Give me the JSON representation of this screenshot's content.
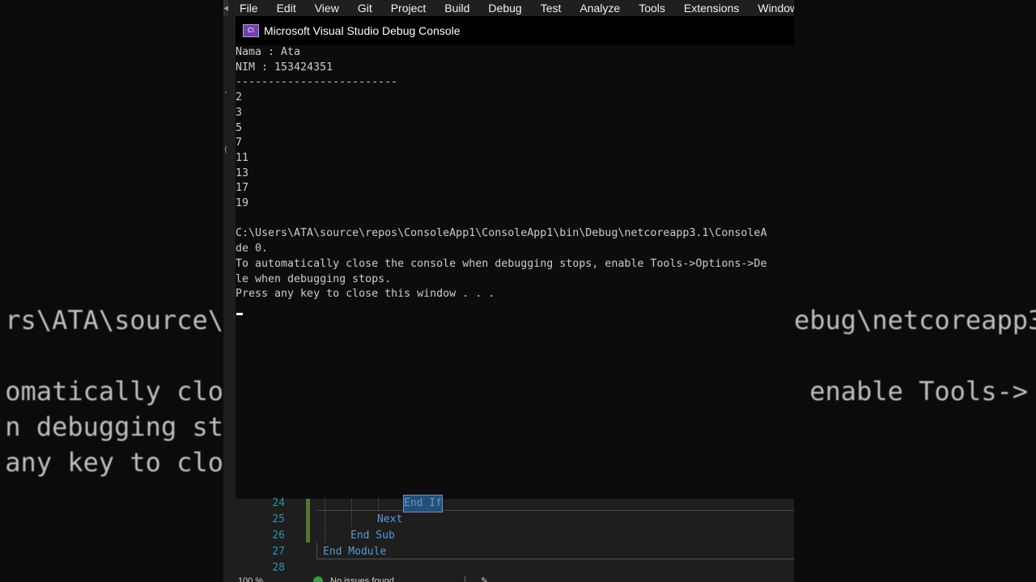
{
  "menu": {
    "items": [
      "File",
      "Edit",
      "View",
      "Git",
      "Project",
      "Build",
      "Debug",
      "Test",
      "Analyze",
      "Tools",
      "Extensions",
      "Window"
    ]
  },
  "console": {
    "icon_label": "C\\",
    "title": "Microsoft Visual Studio Debug Console",
    "lines": [
      "Nama : Ata",
      "NIM : 153424351",
      "-------------------------",
      "2",
      "3",
      "5",
      "7",
      "11",
      "13",
      "17",
      "19",
      "",
      "C:\\Users\\ATA\\source\\repos\\ConsoleApp1\\ConsoleApp1\\bin\\Debug\\netcoreapp3.1\\ConsoleA",
      "de 0.",
      "To automatically close the console when debugging stops, enable Tools->Options->De",
      "le when debugging stops.",
      "Press any key to close this window . . ."
    ]
  },
  "background": {
    "left_lines": [
      "rs\\ATA\\source\\",
      "",
      "omatically clo",
      "n debugging st",
      "any key to clo"
    ],
    "right_lines": [
      "ebug\\netcoreapp3",
      "",
      " enable Tools->",
      "",
      ""
    ]
  },
  "editor": {
    "line_numbers": [
      "24",
      "25",
      "26",
      "27",
      "28"
    ],
    "code": {
      "end_if": "End If",
      "next": "Next",
      "end_sub": "End Sub",
      "end_module": "End Module"
    }
  },
  "statusbar": {
    "zoom": "100 %",
    "issues": "No issues found"
  },
  "colors": {
    "keyword": "#569cd6",
    "line_number": "#2b91af",
    "console_text": "#cccccc"
  }
}
